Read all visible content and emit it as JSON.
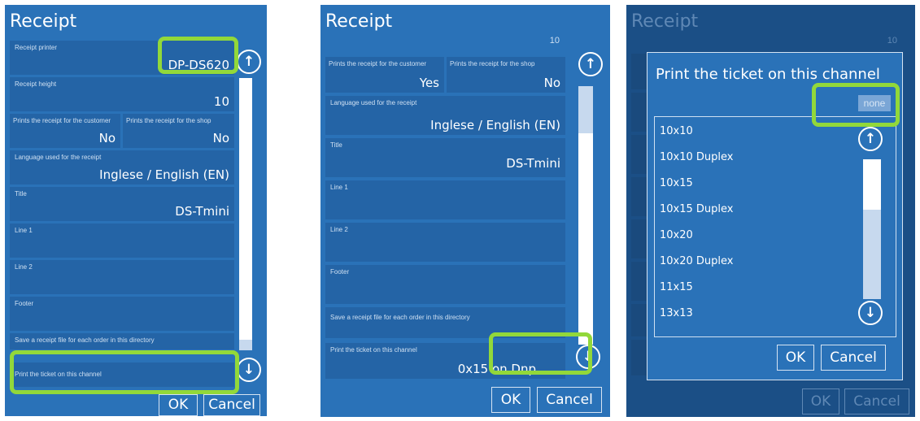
{
  "left": {
    "title": "Receipt",
    "fields": [
      {
        "label": "Receipt printer",
        "value": "DP-DS620"
      },
      {
        "label": "Receipt height",
        "value": "10"
      },
      {
        "label": "Prints the receipt for the customer",
        "value": "No"
      },
      {
        "label": "Prints the receipt for the shop",
        "value": "No"
      },
      {
        "label": "Language used for the receipt",
        "value": "Inglese / English (EN)"
      },
      {
        "label": "Title",
        "value": "DS-Tmini"
      },
      {
        "label": "Line 1",
        "value": ""
      },
      {
        "label": "Line 2",
        "value": ""
      },
      {
        "label": "Footer",
        "value": ""
      },
      {
        "label": "Save a receipt file for each order in this directory",
        "value": ""
      },
      {
        "label": "Print the ticket on this channel",
        "value": ""
      }
    ],
    "ok": "OK",
    "cancel": "Cancel"
  },
  "middle": {
    "title": "Receipt",
    "top_partial": "10",
    "fields": [
      {
        "label": "Prints the receipt for the customer",
        "value": "Yes"
      },
      {
        "label": "Prints the receipt for the shop",
        "value": "No"
      },
      {
        "label": "Language used for the receipt",
        "value": "Inglese / English (EN)"
      },
      {
        "label": "Title",
        "value": "DS-Tmini"
      },
      {
        "label": "Line 1",
        "value": ""
      },
      {
        "label": "Line 2",
        "value": ""
      },
      {
        "label": "Footer",
        "value": ""
      },
      {
        "label": "Save a receipt file for each order in this directory",
        "value": ""
      },
      {
        "label": "Print the ticket on this channel",
        "value": "0x15 on Dnp"
      }
    ],
    "ok": "OK",
    "cancel": "Cancel"
  },
  "right": {
    "title": "Receipt",
    "top_partial": "10",
    "dialog_title": "Print the ticket on this channel",
    "selected": "none",
    "options": [
      "10x10",
      "10x10 Duplex",
      "10x15",
      "10x15 Duplex",
      "10x20",
      "10x20 Duplex",
      "11x15",
      "13x13"
    ],
    "ok": "OK",
    "cancel": "Cancel",
    "behind_ok": "OK",
    "behind_cancel": "Cancel"
  },
  "icons": {
    "up": "arrow-up-circle-icon",
    "down": "arrow-down-circle-icon"
  },
  "colors": {
    "panel": "#2a72b8",
    "field": "#2464a6",
    "highlight": "#92d83a",
    "dimmed": "#1b4f86"
  }
}
